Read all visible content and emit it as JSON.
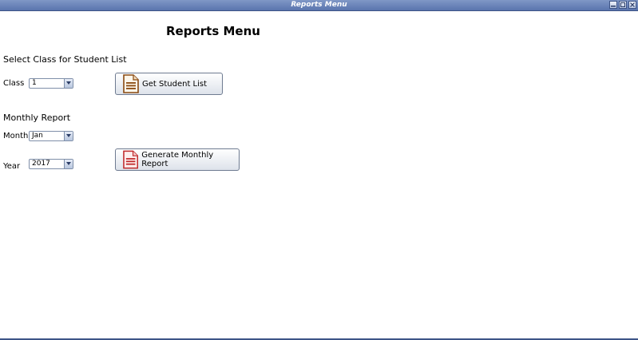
{
  "window": {
    "title": "Reports Menu"
  },
  "page": {
    "heading": "Reports Menu"
  },
  "student_list": {
    "section_title": "Select Class for Student List",
    "class_label": "Class",
    "class_value": "1",
    "button_label": "Get Student List"
  },
  "monthly": {
    "section_title": "Monthly Report",
    "month_label": "Month",
    "month_value": "Jan",
    "year_label": "Year",
    "year_value": "2017",
    "button_label": "Generate Monthly Report"
  },
  "icons": {
    "student_list_icon": "document-icon",
    "monthly_icon": "pdf-document-icon",
    "student_list_color": "#8a4a10",
    "monthly_color": "#c0282a"
  }
}
